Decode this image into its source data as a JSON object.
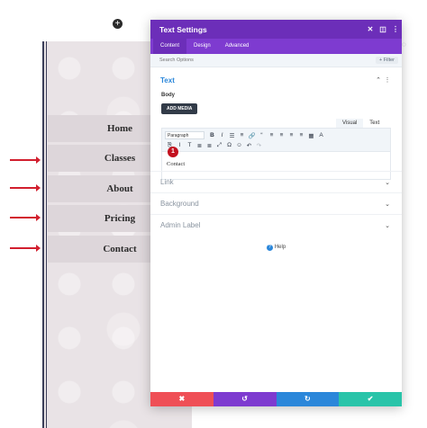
{
  "page_nav": [
    "Home",
    "Classes",
    "About",
    "Pricing",
    "Contact"
  ],
  "colors": {
    "header": "#6c2eb9",
    "tabs": "#7e3bd0",
    "accent_blue": "#2b87da",
    "discard": "#ef4f56",
    "undo": "#7e3bd0",
    "redo": "#2b87da",
    "save": "#29c4a9",
    "arrow": "#d21f2e"
  },
  "panel": {
    "title": "Text Settings",
    "header_icons": [
      "close-icon",
      "expand-icon",
      "more-icon"
    ],
    "tabs": [
      {
        "label": "Content",
        "active": true
      },
      {
        "label": "Design",
        "active": false
      },
      {
        "label": "Advanced",
        "active": false
      }
    ],
    "search": {
      "placeholder": "Search Options",
      "filter_label": "+ Filter"
    },
    "text_section": {
      "title": "Text",
      "body_label": "Body",
      "add_media_label": "ADD MEDIA",
      "visual_label": "Visual",
      "text_label": "Text",
      "format_select": "Paragraph",
      "toolbar_row1": [
        "B",
        "I",
        "☰",
        "≡",
        "🔗",
        "“",
        "≡",
        "≡",
        "≡",
        "≡",
        "▦",
        "A"
      ],
      "toolbar_row2": [
        "⎘",
        "I",
        "T",
        "≣",
        "≣",
        "⤢",
        "Ω",
        "☺",
        "↶",
        "↷"
      ],
      "editor_content": "Contact",
      "marker": "1"
    },
    "collapsed_sections": [
      "Link",
      "Background",
      "Admin Label"
    ],
    "help_label": "Help",
    "footer_buttons": [
      {
        "name": "discard",
        "glyph": "✖"
      },
      {
        "name": "undo",
        "glyph": "↺"
      },
      {
        "name": "redo",
        "glyph": "↻"
      },
      {
        "name": "save",
        "glyph": "✔"
      }
    ]
  },
  "add_module_glyph": "+"
}
